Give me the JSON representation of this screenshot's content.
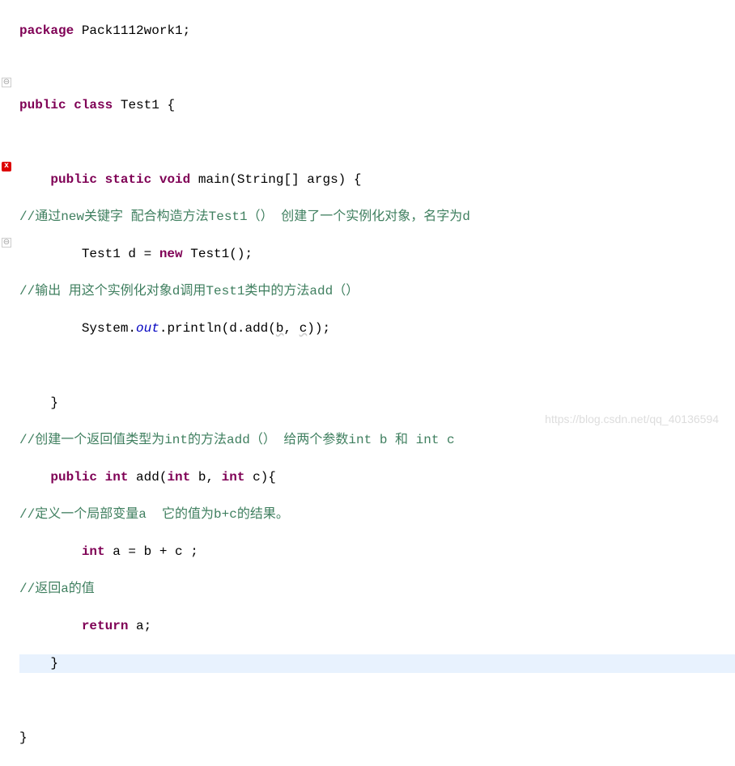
{
  "code": {
    "l1_kw1": "package",
    "l1_rest": " Pack1112work1;",
    "l3_kw1": "public",
    "l3_kw2": "class",
    "l3_rest": " Test1 {",
    "l5_kw1": "public",
    "l5_kw2": "static",
    "l5_kw3": "void",
    "l5_rest": " main(String[] args) {",
    "l6_comment": "//通过new关键字 配合构造方法Test1（） 创建了一个实例化对象，名字为d",
    "l7_pre": "        Test1 d = ",
    "l7_kw": "new",
    "l7_post": " Test1();",
    "l8_comment": "//输出 用这个实例化对象d调用Test1类中的方法add（）",
    "l9_pre": "        System.",
    "l9_out": "out",
    "l9_mid": ".println(d.add(",
    "l9_b": "b",
    "l9_comma": ", ",
    "l9_c": "c",
    "l9_end": "));",
    "l11_brace": "    }",
    "l12_comment": "//创建一个返回值类型为int的方法add（） 给两个参数int b 和 int c",
    "l13_kw1": "public",
    "l13_kw2": "int",
    "l13_mid1": " add(",
    "l13_kw3": "int",
    "l13_mid2": " b, ",
    "l13_kw4": "int",
    "l13_end": " c){",
    "l14_comment": "//定义一个局部变量a  它的值为b+c的结果。",
    "l15_pre": "        ",
    "l15_kw": "int",
    "l15_rest": " a = b + c ;",
    "l16_comment": "//返回a的值",
    "l17_pre": "        ",
    "l17_kw": "return",
    "l17_rest": " a;",
    "l18_brace": "    }",
    "l20_brace": "}"
  },
  "watermark": "https://blog.csdn.net/qq_40136594",
  "markers": {
    "collapse": "⊖",
    "error": "x"
  }
}
